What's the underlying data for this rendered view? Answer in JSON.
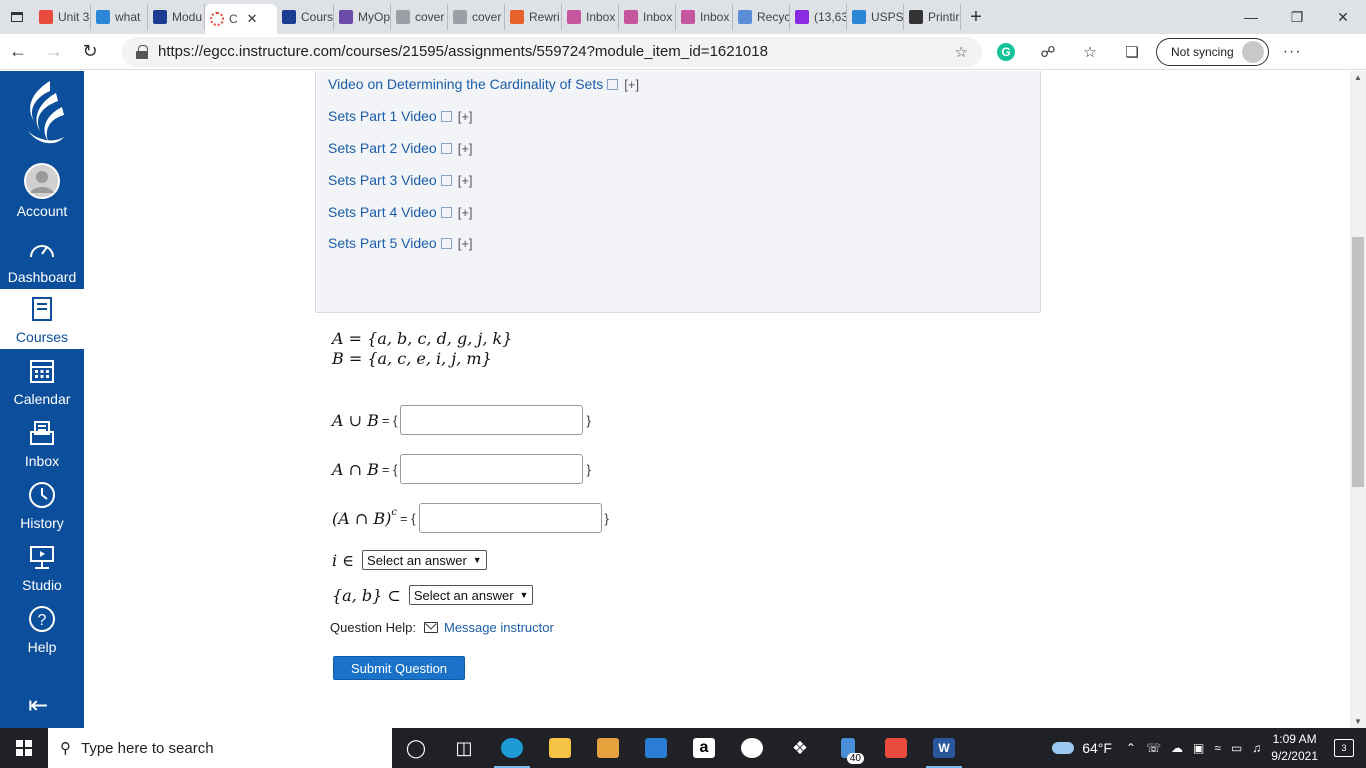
{
  "browser": {
    "tabs": [
      {
        "label": "Unit 3",
        "fav_color": "#e84b3c"
      },
      {
        "label": "what",
        "fav_color": "#2b87d6"
      },
      {
        "label": "Modu",
        "fav_color": "#1b3d91"
      },
      {
        "label": "C",
        "fav_color": "#e84b3c",
        "active": true
      },
      {
        "label": "Cours",
        "fav_color": "#1b3d91"
      },
      {
        "label": "MyOp",
        "fav_color": "#6b4aa8"
      },
      {
        "label": "cover",
        "fav_color": "#9aa0a6"
      },
      {
        "label": "cover",
        "fav_color": "#9aa0a6"
      },
      {
        "label": "Rewri",
        "fav_color": "#e8612c"
      },
      {
        "label": "Inbox",
        "fav_color": "#c6569e"
      },
      {
        "label": "Inbox",
        "fav_color": "#c6569e"
      },
      {
        "label": "Inbox",
        "fav_color": "#c6569e"
      },
      {
        "label": "Recyc",
        "fav_color": "#5a8fd6"
      },
      {
        "label": "(13,63",
        "fav_color": "#8a2be2"
      },
      {
        "label": "USPS",
        "fav_color": "#2b87d6"
      },
      {
        "label": "Printir",
        "fav_color": "#333333"
      }
    ],
    "url": "https://egcc.instructure.com/courses/21595/assignments/559724?module_item_id=1621018",
    "sync_label": "Not syncing"
  },
  "nav": {
    "items": [
      {
        "label": "Account"
      },
      {
        "label": "Dashboard"
      },
      {
        "label": "Courses"
      },
      {
        "label": "Calendar"
      },
      {
        "label": "Inbox"
      },
      {
        "label": "History"
      },
      {
        "label": "Studio"
      },
      {
        "label": "Help"
      }
    ],
    "brand_color": "#0b4e9b"
  },
  "help_links": [
    {
      "label": "Video on Determining the Cardinality of Sets",
      "plus": "[+]"
    },
    {
      "label": "Sets Part 1 Video",
      "plus": "[+]"
    },
    {
      "label": "Sets Part 2 Video",
      "plus": "[+]"
    },
    {
      "label": "Sets Part 3 Video",
      "plus": "[+]"
    },
    {
      "label": "Sets Part 4 Video",
      "plus": "[+]"
    },
    {
      "label": "Sets Part 5 Video",
      "plus": "[+]"
    }
  ],
  "question": {
    "set_a": "A = {a, b, c, d, g, j, k}",
    "set_b": "B = {a, c, e, i, j, m}",
    "union_label": "A ∪ B",
    "intersection_label": "A ∩ B",
    "complement_label": "(A ∩ B)",
    "complement_sup": "c",
    "equals_open": "= {",
    "close_brace": "}",
    "member_label": "i ∈",
    "subset_label": "{a, b} ⊂",
    "select_placeholder": "Select an answer",
    "help_label": "Question Help:",
    "message_label": "Message instructor",
    "submit_label": "Submit Question"
  },
  "taskbar": {
    "search_placeholder": "Type here to search",
    "temperature": "64°F",
    "time": "1:09 AM",
    "date": "9/2/2021",
    "mail_badge": "40",
    "notification_count": "3"
  }
}
